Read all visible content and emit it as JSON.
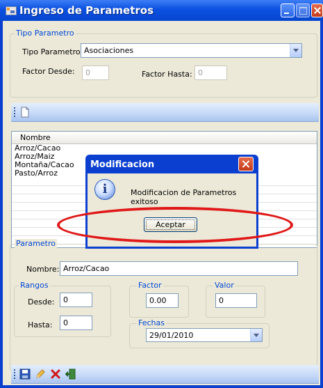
{
  "window": {
    "title": "Ingreso de Parametros"
  },
  "tipo_parametro": {
    "group_label": "Tipo Parametro",
    "tipo_label": "Tipo Parametro",
    "tipo_value": "Asociaciones",
    "factor_desde_label": "Factor Desde:",
    "factor_desde_value": "0",
    "factor_hasta_label": "Factor Hasta:",
    "factor_hasta_value": "0"
  },
  "list": {
    "header": "Nombre",
    "items": [
      "Arroz/Cacao",
      "Arroz/Maiz",
      "Montaña/Cacao",
      "Pasto/Arroz"
    ]
  },
  "parametro": {
    "group_label": "Parametro",
    "nombre_label": "Nombre:",
    "nombre_value": "Arroz/Cacao",
    "rangos_label": "Rangos",
    "desde_label": "Desde:",
    "desde_value": "0",
    "hasta_label": "Hasta:",
    "hasta_value": "0",
    "factor_label": "Factor",
    "factor_value": "0.00",
    "valor_label": "Valor",
    "valor_value": "0",
    "fechas_label": "Fechas",
    "fechas_value": "29/01/2010"
  },
  "dialog": {
    "title": "Modificacion",
    "message": "Modificacion de Parametros exitoso",
    "ok_label": "Aceptar",
    "icon_glyph": "i"
  },
  "toolbar_icons": {
    "top": [
      "new-document-icon"
    ],
    "bottom": [
      "save-icon",
      "edit-icon",
      "delete-icon",
      "exit-icon"
    ]
  },
  "colors": {
    "accent": "#0a3fd0",
    "group_label": "#0046d5",
    "highlight_ellipse": "#e01818"
  }
}
